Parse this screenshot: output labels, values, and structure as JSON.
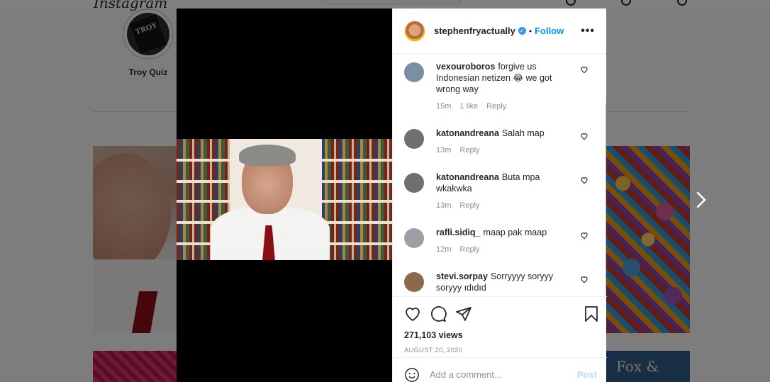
{
  "background": {
    "logo_text": "Instagram",
    "story": {
      "label": "Troy Quiz",
      "book_text": "TROY"
    },
    "tile_text": "Fox &"
  },
  "post": {
    "author": {
      "username": "stephenfryactually",
      "verified": true,
      "follow_label": "Follow",
      "separator": "•",
      "more_label": "•••"
    },
    "comments": [
      {
        "username": "vexouroboros",
        "text": "forgive us Indonesian netizen 😂 we got wrong way",
        "age": "15m",
        "likes": "1 like",
        "reply_label": "Reply",
        "avatar_color": "#7a8fa6"
      },
      {
        "username": "katonandreana",
        "text": "Salah map",
        "age": "13m",
        "likes": "",
        "reply_label": "Reply",
        "avatar_color": "#6f6f6f"
      },
      {
        "username": "katonandreana",
        "text": "Buta mpa wkakwka",
        "age": "13m",
        "likes": "",
        "reply_label": "Reply",
        "avatar_color": "#6f6f6f"
      },
      {
        "username": "rafli.sidiq_",
        "text": "maap pak maap",
        "age": "12m",
        "likes": "",
        "reply_label": "Reply",
        "avatar_color": "#9aa0a6"
      },
      {
        "username": "stevi.sorpay",
        "text": "Sorryyyy soryyy soryyy ıdıdıd",
        "age": "",
        "likes": "",
        "reply_label": "",
        "avatar_color": "#8a6a4a"
      }
    ],
    "icons": {
      "like": "heart-icon",
      "comment": "comment-icon",
      "share": "share-icon",
      "save": "bookmark-icon",
      "emoji": "emoji-icon",
      "next": "chevron-right-icon"
    },
    "views": "271,103 views",
    "date": "AUGUST 20, 2020",
    "add_comment": {
      "placeholder": "Add a comment...",
      "post_label": "Post"
    }
  },
  "colors": {
    "accent": "#0095f6",
    "verified": "#3897f0",
    "post_disabled": "#b2dffc",
    "muted_text": "#8e8e8e"
  }
}
